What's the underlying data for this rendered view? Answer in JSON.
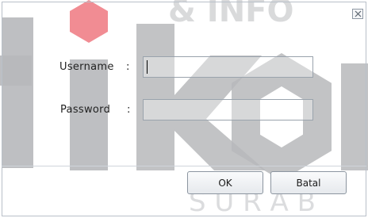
{
  "watermark": {
    "line1": "& INFO",
    "big_text": "tikom",
    "line2": "S U R A B"
  },
  "dialog": {
    "close_glyph": "×",
    "username_label": "Username",
    "password_label": "Password",
    "colon": ":",
    "username_value": "",
    "password_value": "",
    "ok_label": "OK",
    "cancel_label": "Batal"
  },
  "colors": {
    "watermark_gray": "#b9b9bb",
    "watermark_red": "#e96a74",
    "border": "#9aa3ad"
  }
}
